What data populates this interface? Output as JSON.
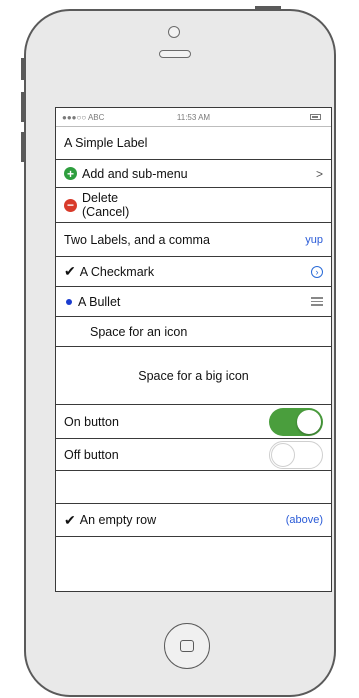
{
  "status_bar": {
    "carrier": "●●●○○ ABC",
    "time": "11:53 AM",
    "battery_icon": "battery-icon"
  },
  "rows": {
    "simple_label": "A Simple Label",
    "add_submenu": {
      "icon": "plus-circle-icon",
      "label": "Add and sub-menu",
      "chevron": ">"
    },
    "delete": {
      "icon": "minus-circle-icon",
      "line1": "Delete",
      "line2": "(Cancel)"
    },
    "two_labels": {
      "left": "Two Labels, and a comma",
      "right": "yup"
    },
    "checkmark": {
      "check": "✔",
      "label": "A Checkmark",
      "accessory": "info-circle-icon"
    },
    "bullet": {
      "label": "A Bullet",
      "accessory": "hamburger-icon"
    },
    "space_icon": "Space for an icon",
    "space_big_icon": "Space for a big icon",
    "on_button": {
      "label": "On button",
      "state": "on"
    },
    "off_button": {
      "label": "Off button",
      "state": "off"
    },
    "empty_row": "",
    "empty_row_label": {
      "check": "✔",
      "label": "An empty row",
      "right": "(above)"
    }
  },
  "colors": {
    "accent_blue": "#2a5bd7",
    "toggle_green": "#4a9e3d",
    "add_green": "#2e9e3e",
    "delete_red": "#d83a2a"
  }
}
